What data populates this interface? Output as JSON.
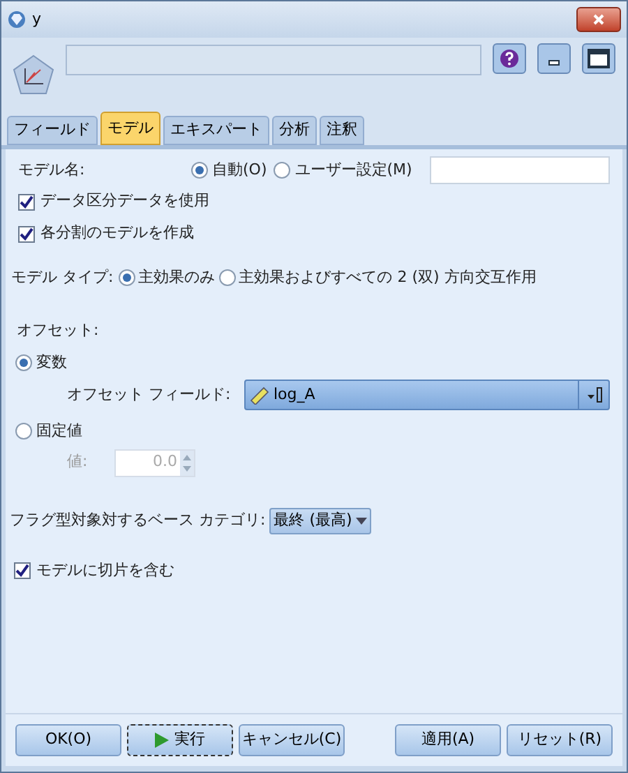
{
  "window": {
    "title": "y"
  },
  "tabs": [
    {
      "label": "フィールド",
      "selected": false
    },
    {
      "label": "モデル",
      "selected": true
    },
    {
      "label": "エキスパート",
      "selected": false
    },
    {
      "label": "分析",
      "selected": false
    },
    {
      "label": "注釈",
      "selected": false
    }
  ],
  "model_name": {
    "label": "モデル名:",
    "options": [
      {
        "label": "自動(O)",
        "selected": true
      },
      {
        "label": "ユーザー設定(M)",
        "selected": false
      }
    ]
  },
  "checkboxes_top": [
    {
      "label": "データ区分データを使用",
      "checked": true
    },
    {
      "label": "各分割のモデルを作成",
      "checked": true
    }
  ],
  "model_type": {
    "label": "モデル タイプ:",
    "options": [
      {
        "label": "主効果のみ",
        "selected": true
      },
      {
        "label": "主効果およびすべての 2 (双) 方向交互作用",
        "selected": false
      }
    ]
  },
  "offset": {
    "label": "オフセット:",
    "variable": {
      "label": "変数",
      "selected": true
    },
    "field_label": "オフセット フィールド:",
    "field_value": "log_A",
    "fixed": {
      "label": "固定値",
      "selected": false
    },
    "value_label": "値:",
    "value": "0.0"
  },
  "base_category": {
    "label": "フラグ型対象対するベース カテゴリ:",
    "value": "最終 (最高)"
  },
  "intercept": {
    "label": "モデルに切片を含む",
    "checked": true
  },
  "buttons": [
    {
      "label": "OK(O)",
      "kind": "plain"
    },
    {
      "label": "実行",
      "kind": "run"
    },
    {
      "label": "キャンセル(C)",
      "kind": "plain"
    },
    {
      "label": "適用(A)",
      "kind": "plain"
    },
    {
      "label": "リセット(R)",
      "kind": "plain"
    }
  ]
}
